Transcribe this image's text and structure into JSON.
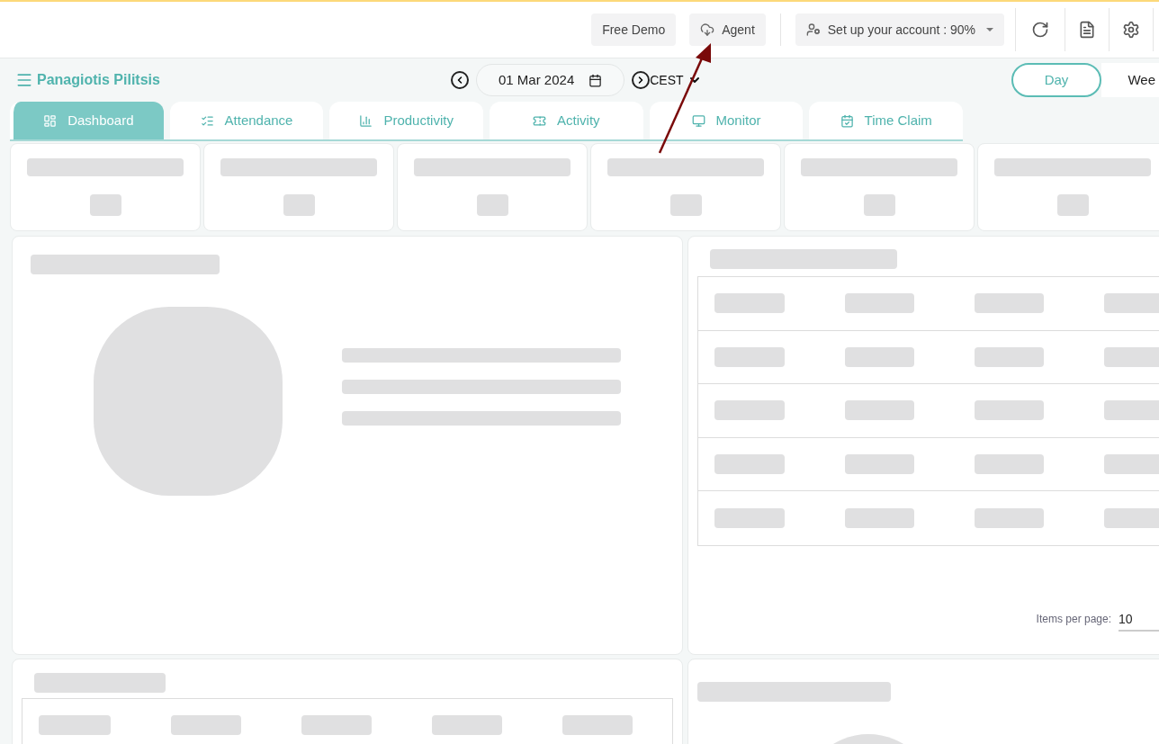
{
  "topbar": {
    "buttons": [
      {
        "kind": "text",
        "label": "Free Demo"
      },
      {
        "kind": "agent",
        "label": "Agent"
      },
      {
        "kind": "account",
        "label": "Set up your account : 90%"
      }
    ]
  },
  "header": {
    "user": "Panagiotis Pilitsis",
    "date": "01 Mar 2024",
    "timezone": "CEST",
    "range": [
      {
        "label": "Day",
        "selected": true
      },
      {
        "label": "Wee",
        "selected": false
      }
    ]
  },
  "tabs": [
    {
      "label": "Dashboard",
      "selected": true
    },
    {
      "label": "Attendance",
      "selected": false
    },
    {
      "label": "Productivity",
      "selected": false
    },
    {
      "label": "Activity",
      "selected": false
    },
    {
      "label": "Monitor",
      "selected": false
    },
    {
      "label": "Time Claim",
      "selected": false
    }
  ],
  "pagination": {
    "label": "Items per page:",
    "value": "10"
  }
}
